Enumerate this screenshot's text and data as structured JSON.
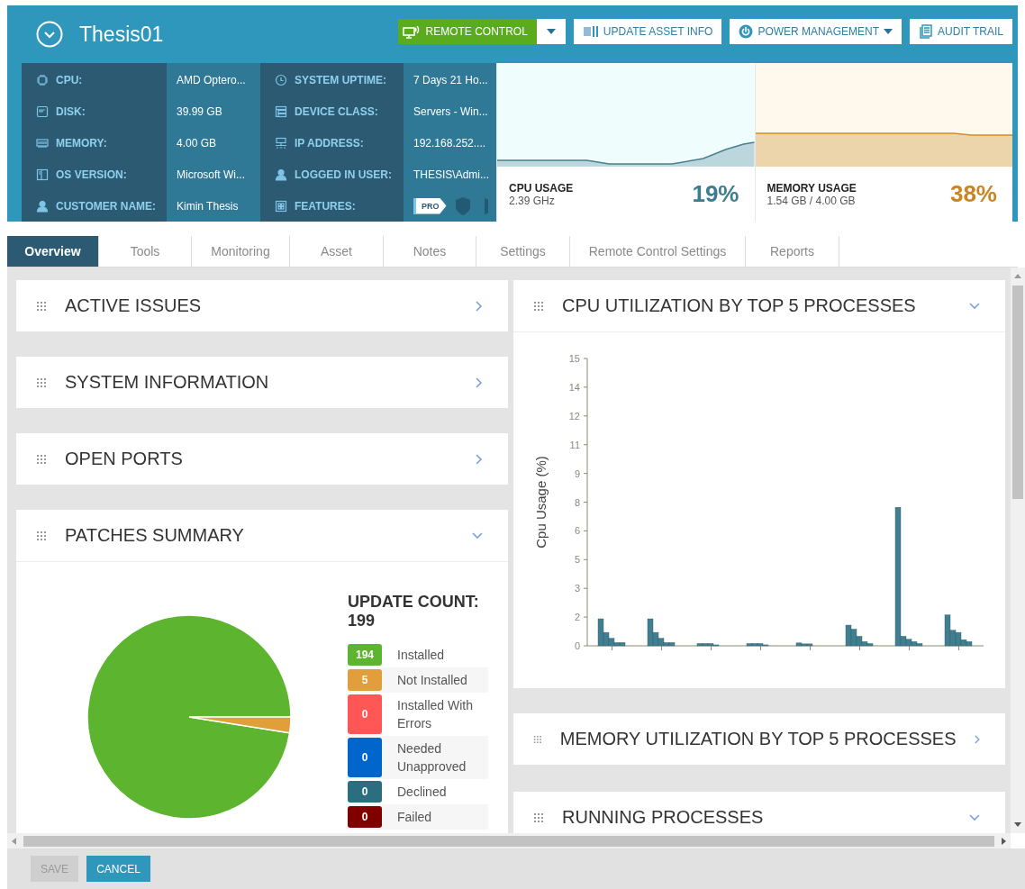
{
  "device": {
    "name": "Thesis01"
  },
  "actions": [
    {
      "kind": "remote",
      "label": "REMOTE CONTROL",
      "split_dropdown": true
    },
    {
      "kind": "update",
      "label": "UPDATE ASSET INFO"
    },
    {
      "kind": "power",
      "label": "POWER MANAGEMENT",
      "menu_caret": true
    },
    {
      "kind": "audit",
      "label": "AUDIT TRAIL"
    }
  ],
  "info": {
    "columns": [
      [
        {
          "kind": "cpu",
          "label": "CPU:",
          "value": "AMD Optero..."
        },
        {
          "kind": "disk",
          "label": "DISK:",
          "value": "39.99 GB"
        },
        {
          "kind": "memory",
          "label": "MEMORY:",
          "value": "4.00 GB"
        },
        {
          "kind": "os",
          "label": "OS VERSION:",
          "value": "Microsoft Wi..."
        },
        {
          "kind": "person",
          "label": "CUSTOMER NAME:",
          "value": "Kimin Thesis"
        }
      ],
      [
        {
          "kind": "clock",
          "label": "SYSTEM UPTIME:",
          "value": "7 Days 21 Ho..."
        },
        {
          "kind": "device",
          "label": "DEVICE CLASS:",
          "value": "Servers - Win..."
        },
        {
          "kind": "network",
          "label": "IP ADDRESS:",
          "value": "192.168.252...."
        },
        {
          "kind": "person",
          "label": "LOGGED IN USER:",
          "value": "THESIS\\Admi..."
        },
        {
          "kind": "features",
          "label": "FEATURES:",
          "badges": [
            "PRO"
          ]
        }
      ]
    ]
  },
  "usage": [
    {
      "kind": "cpu",
      "title": "CPU USAGE",
      "detail": "2.39 GHz",
      "percent": "19%"
    },
    {
      "kind": "memory",
      "title": "MEMORY USAGE",
      "detail": "1.54 GB / 4.00 GB",
      "percent": "38%"
    }
  ],
  "tabs": [
    {
      "label": "Overview",
      "selected": true
    },
    {
      "label": "Tools",
      "selected": false
    },
    {
      "label": "Monitoring",
      "selected": false
    },
    {
      "label": "Asset",
      "selected": false
    },
    {
      "label": "Notes",
      "selected": false
    },
    {
      "label": "Settings",
      "selected": false
    },
    {
      "label": "Remote Control Settings",
      "selected": false
    },
    {
      "label": "Reports",
      "selected": false
    }
  ],
  "left_panels": [
    {
      "title": "ACTIVE ISSUES",
      "expanded": false
    },
    {
      "title": "SYSTEM INFORMATION",
      "expanded": false
    },
    {
      "title": "OPEN PORTS",
      "expanded": false
    },
    {
      "title": "PATCHES SUMMARY",
      "expanded": true,
      "kind": "patches",
      "count_label": "UPDATE COUNT:",
      "count": "199",
      "legend": [
        {
          "count": "194",
          "label": "Installed",
          "color": "#5db42f"
        },
        {
          "count": "5",
          "label": "Not Installed",
          "color": "#e09f3a"
        },
        {
          "count": "0",
          "label": "Installed With Errors",
          "color": "#ff5656"
        },
        {
          "count": "0",
          "label": "Needed Unapproved",
          "color": "#0066cc"
        },
        {
          "count": "0",
          "label": "Declined",
          "color": "#2a6e80"
        },
        {
          "count": "0",
          "label": "Failed",
          "color": "#800000"
        }
      ],
      "chart_data": {
        "type": "pie",
        "values": [
          97.49,
          2.51,
          0,
          0,
          0,
          0
        ]
      }
    }
  ],
  "right_panels": [
    {
      "title": "CPU UTILIZATION BY TOP 5 PROCESSES",
      "expanded": true,
      "kind": "chart",
      "chart_data": {
        "type": "bar",
        "ylabel": "Cpu Usage (%)",
        "ylim": [
          0,
          15
        ],
        "yticks": [
          0,
          {
            "value": 1.5,
            "label": "2"
          },
          3,
          {
            "value": 4.5,
            "label": "5"
          },
          6,
          {
            "value": 7.5,
            "label": "8"
          },
          9,
          {
            "value": 10.5,
            "label": "11"
          },
          12,
          {
            "value": 13.5,
            "label": "14"
          },
          15
        ],
        "series": [
          {
            "color": "#417f90",
            "values": [
              1.41,
              1.41,
              0.12,
              0.12,
              0.15,
              1.08,
              7.23,
              1.61
            ]
          },
          {
            "color": "#417f90",
            "values": [
              0.7,
              0.7,
              0.12,
              0.12,
              0.1,
              0.87,
              0.5,
              0.81
            ]
          },
          {
            "color": "#417f90",
            "values": [
              0.39,
              0.39,
              0.12,
              0.12,
              0.1,
              0.5,
              0.34,
              0.7
            ]
          },
          {
            "color": "#417f90",
            "values": [
              0.17,
              0.17,
              0.05,
              0.05,
              0,
              0.22,
              0.22,
              0.32
            ]
          },
          {
            "color": "#417f90",
            "values": [
              0.17,
              0.17,
              0,
              0,
              0,
              0.12,
              0.12,
              0.22
            ]
          }
        ]
      }
    },
    {
      "title": "MEMORY UTILIZATION BY TOP 5 PROCESSES",
      "expanded": false
    },
    {
      "title": "RUNNING PROCESSES",
      "expanded": true
    }
  ],
  "footer": [
    {
      "label": "SAVE",
      "disabled": true
    },
    {
      "label": "CANCEL",
      "disabled": false
    }
  ]
}
